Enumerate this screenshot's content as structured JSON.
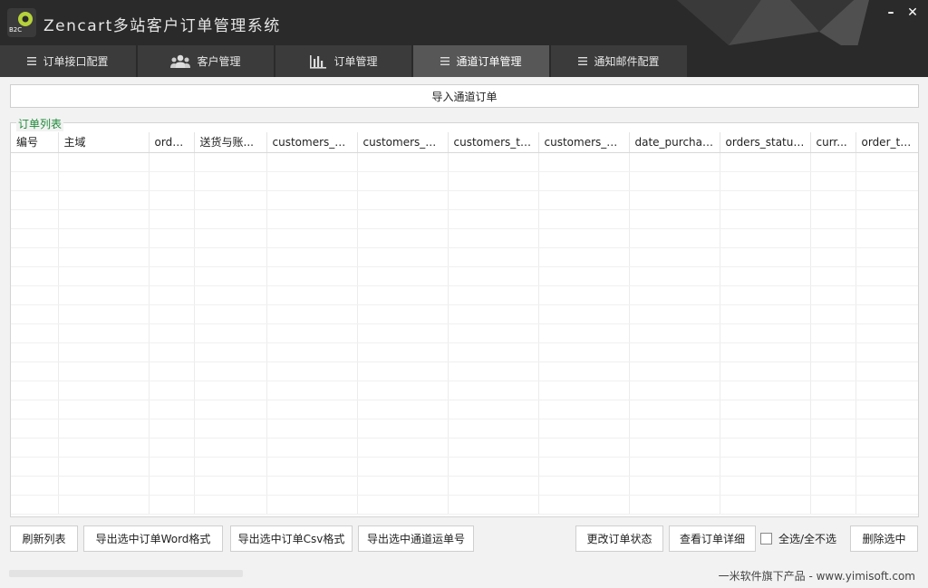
{
  "window": {
    "title": "Zencart多站客户订单管理系统",
    "logo_text": "B2C",
    "minimize_label": "–",
    "close_label": "✕"
  },
  "tabs": [
    {
      "label": "订单接口配置",
      "icon": "list-icon",
      "active": false
    },
    {
      "label": "客户管理",
      "icon": "users-icon",
      "active": false
    },
    {
      "label": "订单管理",
      "icon": "bar-chart-icon",
      "active": false
    },
    {
      "label": "通道订单管理",
      "icon": "list-icon",
      "active": true
    },
    {
      "label": "通知邮件配置",
      "icon": "list-icon",
      "active": false
    }
  ],
  "import_button": "导入通道订单",
  "order_list": {
    "title": "订单列表",
    "columns": [
      "编号",
      "主域",
      "orde...",
      "送货与账...",
      "customers_na...",
      "customers_co...",
      "customers_tel...",
      "customers_e...",
      "date_purchas...",
      "orders_status...",
      "curr...",
      "order_total"
    ],
    "rows": []
  },
  "actions": {
    "refresh": "刷新列表",
    "export_word": "导出选中订单Word格式",
    "export_csv": "导出选中订单Csv格式",
    "export_tracking": "导出选中通道运单号",
    "change_status": "更改订单状态",
    "view_detail": "查看订单详细",
    "select_all": "全选/全不选",
    "delete_selected": "删除选中"
  },
  "footer": {
    "vendor": "一米软件旗下产品 - www.yimisoft.com"
  },
  "colors": {
    "titlebar_bg": "#2a2a2a",
    "tab_bg": "#3b3b3b",
    "tab_active_bg": "#575757",
    "legend_green": "#1e8a3a"
  }
}
